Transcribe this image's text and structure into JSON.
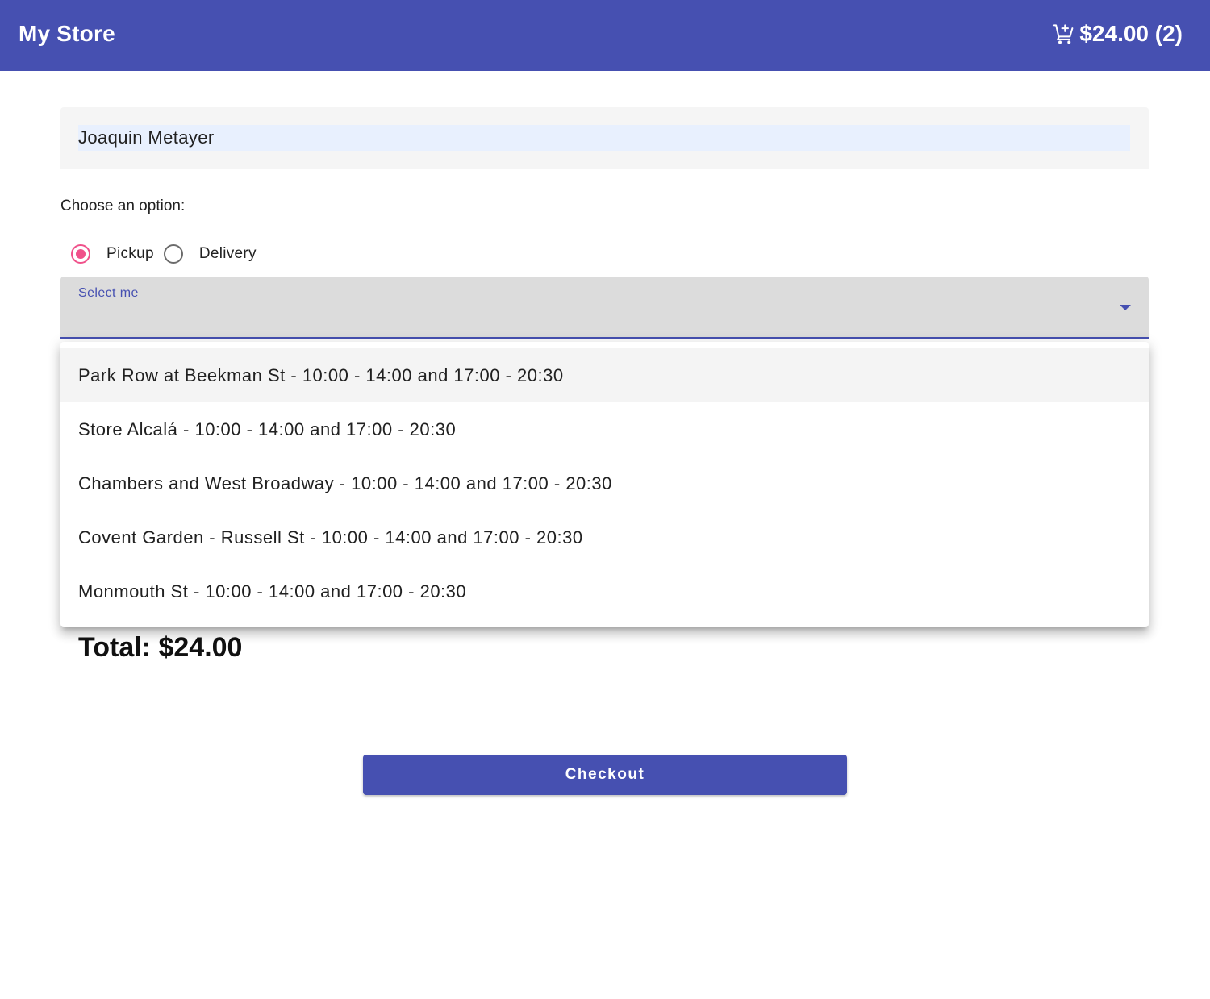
{
  "header": {
    "title": "My Store",
    "cart_icon": "add-shopping-cart-icon",
    "cart_summary": "$24.00 (2)"
  },
  "form": {
    "name_value": "Joaquin Metayer",
    "choose_label": "Choose an option:",
    "options": [
      {
        "label": "Pickup",
        "checked": true
      },
      {
        "label": "Delivery",
        "checked": false
      }
    ],
    "select_label": "Select me",
    "select_arrow_icon": "arrow-drop-down-icon"
  },
  "dropdown": {
    "items": [
      "Park Row at Beekman St - 10:00 - 14:00 and 17:00 - 20:30",
      "Store Alcalá - 10:00 - 14:00 and 17:00 - 20:30",
      "Chambers and West Broadway - 10:00 - 14:00 and 17:00 - 20:30",
      "Covent Garden - Russell St - 10:00 - 14:00 and 17:00 - 20:30",
      "Monmouth St - 10:00 - 14:00 and 17:00 - 20:30"
    ],
    "highlighted_index": 0
  },
  "summary": {
    "total": "Total: $24.00"
  },
  "actions": {
    "checkout_label": "Checkout"
  },
  "colors": {
    "primary": "#4650b1",
    "accent": "#f0508a",
    "field_bg": "#f5f5f5",
    "autofill_bg": "#e8f0fe"
  }
}
